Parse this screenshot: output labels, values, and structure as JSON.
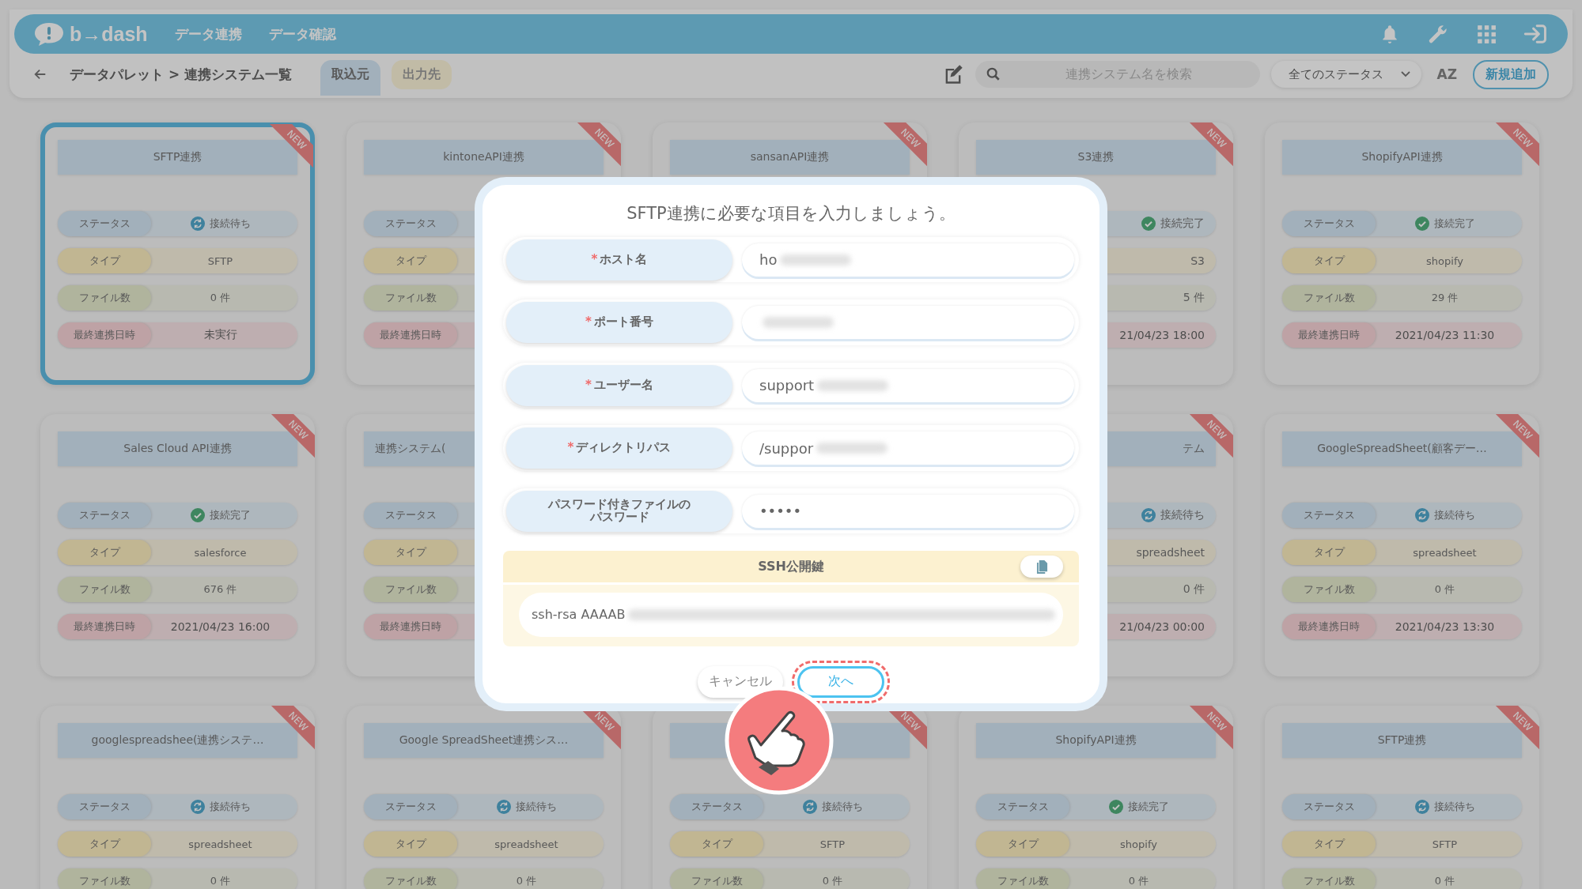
{
  "header": {
    "logo": "b→dash",
    "nav": [
      {
        "label": "データ連携"
      },
      {
        "label": "データ確認"
      }
    ]
  },
  "subheader": {
    "breadcrumb": "データパレット > 連携システム一覧",
    "tabs": [
      {
        "label": "取込元",
        "selected": true
      },
      {
        "label": "出力先",
        "selected": false
      }
    ],
    "search": {
      "placeholder": "連携システム名を検索"
    },
    "status_filter": "全てのステータス",
    "sort": "AZ",
    "add_button": "新規追加"
  },
  "cards": [
    {
      "title": "SFTP連携",
      "selected": true,
      "badge": "NEW",
      "rows": [
        {
          "kind": "status",
          "label": "ステータス",
          "value": "接続待ち",
          "connected": false
        },
        {
          "kind": "type",
          "label": "タイプ",
          "value": "SFTP"
        },
        {
          "kind": "files",
          "label": "ファイル数",
          "value": "0 件"
        },
        {
          "kind": "date",
          "label": "最終連携日時",
          "value": "未実行"
        }
      ]
    },
    {
      "title": "kintoneAPI連携",
      "selected": false,
      "badge": "NEW",
      "rows": [
        {
          "kind": "status",
          "label": "ステータス"
        },
        {
          "kind": "type",
          "label": "タイプ"
        },
        {
          "kind": "files",
          "label": "ファイル数"
        },
        {
          "kind": "date",
          "label": "最終連携日時"
        }
      ]
    },
    {
      "title": "sansanAPI連携",
      "selected": false,
      "badge": "NEW"
    },
    {
      "title": "S3連携",
      "selected": false,
      "badge": "NEW",
      "rows": [
        {
          "kind": "status",
          "value": "接続完了",
          "connected": true
        },
        {
          "kind": "type",
          "value": "S3"
        },
        {
          "kind": "files",
          "value": "5 件"
        },
        {
          "kind": "date",
          "value": "21/04/23 18:00"
        }
      ]
    },
    {
      "title": "ShopifyAPI連携",
      "selected": false,
      "badge": "NEW",
      "rows": [
        {
          "kind": "status",
          "label": "ステータス",
          "value": "接続完了",
          "connected": true
        },
        {
          "kind": "type",
          "label": "タイプ",
          "value": "shopify"
        },
        {
          "kind": "files",
          "label": "ファイル数",
          "value": "29 件"
        },
        {
          "kind": "date",
          "label": "最終連携日時",
          "value": "2021/04/23 11:30"
        }
      ]
    },
    {
      "title": "Sales Cloud API連携",
      "selected": false,
      "badge": "NEW",
      "rows": [
        {
          "kind": "status",
          "label": "ステータス",
          "value": "接続完了",
          "connected": true
        },
        {
          "kind": "type",
          "label": "タイプ",
          "value": "salesforce"
        },
        {
          "kind": "files",
          "label": "ファイル数",
          "value": "676 件"
        },
        {
          "kind": "date",
          "label": "最終連携日時",
          "value": "2021/04/23 16:00"
        }
      ]
    },
    {
      "title": "連携システム(",
      "selected": false,
      "rows": [
        {
          "kind": "status",
          "label": "ステータス"
        },
        {
          "kind": "type",
          "label": "タイプ"
        },
        {
          "kind": "files",
          "label": "ファイル数"
        },
        {
          "kind": "date",
          "label": "最終連携日時"
        }
      ]
    },
    {
      "title": "テム",
      "selected": false,
      "badge": "NEW",
      "rows": [
        {
          "kind": "status",
          "value": "接続待ち",
          "connected": false
        },
        {
          "kind": "type",
          "value": "spreadsheet"
        },
        {
          "kind": "files",
          "value": "0 件"
        },
        {
          "kind": "date",
          "value": "21/04/23 00:00"
        }
      ]
    },
    {
      "title": "GoogleSpreadSheet(顧客デー…",
      "selected": false,
      "badge": "NEW",
      "rows": [
        {
          "kind": "status",
          "label": "ステータス",
          "value": "接続待ち",
          "connected": false
        },
        {
          "kind": "type",
          "label": "タイプ",
          "value": "spreadsheet"
        },
        {
          "kind": "files",
          "label": "ファイル数",
          "value": "0 件"
        },
        {
          "kind": "date",
          "label": "最終連携日時",
          "value": "2021/04/23 13:30"
        }
      ]
    },
    {
      "title": "googlespreadshee(連携システ…",
      "selected": false,
      "badge": "NEW",
      "rows": [
        {
          "kind": "status",
          "label": "ステータス",
          "value": "接続待ち",
          "connected": false
        },
        {
          "kind": "type",
          "label": "タイプ",
          "value": "spreadsheet"
        },
        {
          "kind": "files",
          "label": "ファイル数",
          "value": "0 件"
        }
      ]
    },
    {
      "title": "Google SpreadSheet連携シス…",
      "selected": false,
      "badge": "NEW",
      "rows": [
        {
          "kind": "status",
          "label": "ステータス",
          "value": "接続待ち",
          "connected": false
        },
        {
          "kind": "type",
          "label": "タイプ",
          "value": "spreadsheet"
        },
        {
          "kind": "files",
          "label": "ファイル数",
          "value": "0 件"
        }
      ]
    },
    {
      "selected": false,
      "badge": "NEW",
      "rows": [
        {
          "kind": "status",
          "label": "ステータス",
          "value": "接続待ち",
          "connected": false
        },
        {
          "kind": "type",
          "label": "タイプ",
          "value": "SFTP"
        },
        {
          "kind": "files",
          "label": "ファイル数",
          "value": "0 件"
        }
      ]
    },
    {
      "title": "ShopifyAPI連携",
      "selected": false,
      "badge": "NEW",
      "rows": [
        {
          "kind": "status",
          "label": "ステータス",
          "value": "接続完了",
          "connected": true
        },
        {
          "kind": "type",
          "label": "タイプ",
          "value": "shopify"
        },
        {
          "kind": "files",
          "label": "ファイル数",
          "value": "0 件"
        }
      ]
    },
    {
      "title": "SFTP連携",
      "selected": false,
      "badge": "NEW",
      "rows": [
        {
          "kind": "status",
          "label": "ステータス",
          "value": "接続待ち",
          "connected": false
        },
        {
          "kind": "type",
          "label": "タイプ",
          "value": "SFTP"
        },
        {
          "kind": "files",
          "label": "ファイル数",
          "value": "0 件"
        }
      ]
    }
  ],
  "dialog": {
    "title": "SFTP連携に必要な項目を入力しましょう。",
    "fields": [
      {
        "label": "ホスト名",
        "required_mark": "*",
        "value": "ho",
        "redacted": true
      },
      {
        "label": "ポート番号",
        "required_mark": "*",
        "redacted": true
      },
      {
        "label": "ユーザー名",
        "required_mark": "*",
        "value": "support",
        "redacted": true
      },
      {
        "label": "ディレクトリパス",
        "required_mark": "*",
        "value": "/suppor",
        "redacted": true
      },
      {
        "label": "パスワード付きファイルのパスワード",
        "value": "•••••"
      }
    ],
    "ssh": {
      "title": "SSH公開鍵",
      "value": "ssh-rsa AAAAB",
      "redacted": true
    },
    "buttons": [
      {
        "label": "キャンセル",
        "kind": "secondary",
        "highlighted": false
      },
      {
        "label": "次へ",
        "kind": "primary",
        "highlighted": true
      }
    ]
  }
}
